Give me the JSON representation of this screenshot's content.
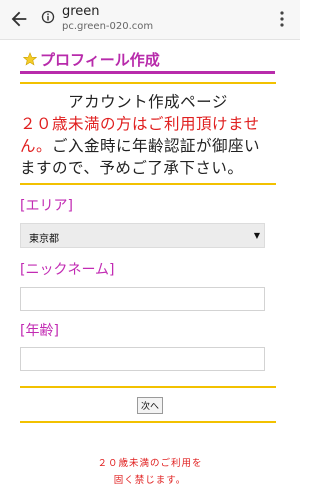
{
  "browser": {
    "title": "green",
    "url": "pc.green-020.com",
    "icons": {
      "back": "arrow-left-icon",
      "info": "info-icon",
      "menu": "more-vert-icon"
    }
  },
  "page": {
    "title": "プロフィール作成",
    "title_icon": "star-icon",
    "accent_color": "#b82bab",
    "divider_color": "#f2c100",
    "warning_color": "#e02020"
  },
  "intro": {
    "heading": "アカウント作成ページ",
    "warning": "２０歳未満の方はご利用頂けません。",
    "body": "ご入金時に年齢認証が御座いますので、予めご了承下さい。"
  },
  "form": {
    "area_label": "[エリア]",
    "area_value": "東京都",
    "area_arrow": "▼",
    "nickname_label": "[ニックネーム]",
    "nickname_value": "",
    "age_label": "[年齢]",
    "age_value": "",
    "submit_label": "次へ"
  },
  "footer": {
    "line1": "２０歳未満のご利用を",
    "line2": "固く禁じます。"
  }
}
